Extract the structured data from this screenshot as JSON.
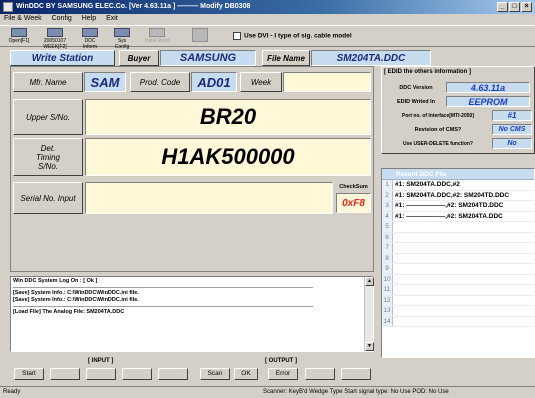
{
  "window": {
    "title": "WinDDC BY SAMSUNG ELEC.Co. [Ver 4.63.11a ] ——— Modify DB0308",
    "controls": [
      "_",
      "□",
      "×"
    ]
  },
  "menu": [
    "File & Week",
    "Config",
    "Help",
    "Exit"
  ],
  "toolbar": {
    "buttons": [
      {
        "label": "Open[F1]",
        "icon": "open-folder-icon"
      },
      {
        "label": "20050107 WEEK[F2]",
        "icon": "calendar-icon"
      },
      {
        "label": "DDC Inform",
        "icon": "inform-icon"
      },
      {
        "label": "Sys Config",
        "icon": "config-icon"
      },
      {
        "label": "Initial Read",
        "icon": "read-icon"
      },
      {
        "label": "",
        "icon": "write-icon"
      }
    ],
    "dvi_checkbox_label": "Use DVI - I type of sig. cable model",
    "dvi_checked": false
  },
  "header": {
    "mode": "Write Station",
    "buyer_label": "Buyer",
    "buyer_value": "SAMSUNG",
    "file_name_label": "File Name",
    "file_name_value": "SM204TA.DDC"
  },
  "fields": {
    "mfr_name_label": "Mfr. Name",
    "mfr_name_value": "SAM",
    "prod_code_label": "Prod. Code",
    "prod_code_value": "AD01",
    "week_label": "Week",
    "week_value": "",
    "upper_sno_label": "Upper S/No.",
    "upper_sno_value": "BR20",
    "det_timing_label": "Det. Timing S/No.",
    "det_timing_value": "H1AK500000",
    "serial_input_label": "Serial No. Input",
    "serial_input_value": "",
    "checksum_label": "CheckSum",
    "checksum_value": "0xF8"
  },
  "edid_info": {
    "title": "[ EDID the others information ]",
    "rows": [
      {
        "label": "DDC Version",
        "value": "4.63.11a"
      },
      {
        "label": "EDID Writed In",
        "value": "EEPROM"
      },
      {
        "label": "Port no. of Interface[MTI-2050]",
        "value": "#1"
      },
      {
        "label": "Revision of CMS?",
        "value": "No CMS"
      },
      {
        "label": "Use USER-DELETE function?",
        "value": "No"
      }
    ]
  },
  "recent": {
    "title": "Recent DDC File",
    "items": [
      "#1: SM204TA.DDC,#2",
      "#1: SM204TA.DDC,#2: SM204TD.DDC",
      "#1: ——————,#2: SM204TD.DDC",
      "#1: ——————,#2: SM204TA.DDC",
      "",
      "",
      "",
      "",
      "",
      "",
      "",
      "",
      "",
      ""
    ]
  },
  "log": {
    "lines": [
      "Win DDC System Log On : [ Ok ]",
      "[Save] System Info.: C:\\WinDDC\\WinDDC.ini file.",
      "[Save] System Info.: C:\\WinDDC\\WinDDC.ini file.",
      "[Load File] The Analog File: SM204TA.DDC"
    ]
  },
  "groups": {
    "input_label": "[ INPUT ]",
    "output_label": "[ OUTPUT ]"
  },
  "buttons": {
    "start": "Start",
    "scan": "Scan",
    "ok": "OK",
    "error": "Error"
  },
  "status": {
    "left": "Ready",
    "right": "Scanner: KeyB'd Wedge Type   Start signal type: No Use   POD: No Use"
  }
}
